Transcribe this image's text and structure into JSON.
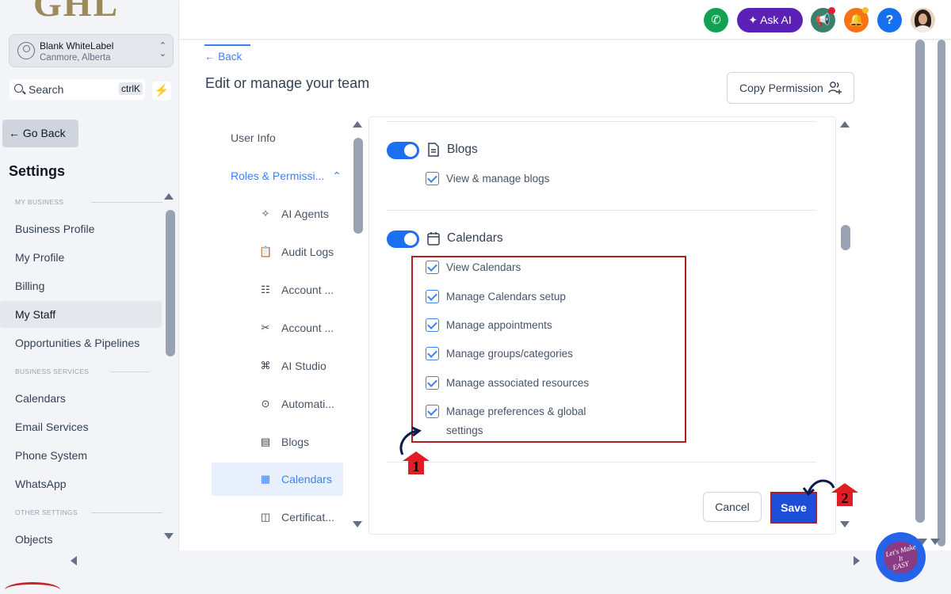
{
  "brand": {
    "logo_text": "GHL"
  },
  "account": {
    "name": "Blank WhiteLabel",
    "location": "Canmore, Alberta"
  },
  "search": {
    "label": "Search",
    "shortcut": "ctrlK"
  },
  "sidebar": {
    "go_back": "← Go Back",
    "title": "Settings",
    "sections": {
      "my_business": "MY BUSINESS",
      "business_services": "BUSINESS SERVICES",
      "other_settings": "OTHER SETTINGS"
    },
    "items": [
      {
        "label": "Business Profile"
      },
      {
        "label": "My Profile"
      },
      {
        "label": "Billing"
      },
      {
        "label": "My Staff",
        "active": true
      },
      {
        "label": "Opportunities & Pipelines"
      },
      {
        "label": "Calendars"
      },
      {
        "label": "Email Services"
      },
      {
        "label": "Phone System"
      },
      {
        "label": "WhatsApp"
      },
      {
        "label": "Objects"
      }
    ]
  },
  "topbar": {
    "ask_ai": "Ask AI",
    "help": "?",
    "colors": {
      "phone": "#12a150",
      "ask_ai": "#5b21b6",
      "megaphone": "#3b7f6d",
      "bell": "#f97316",
      "help": "#1570ef"
    }
  },
  "main": {
    "back": "← Back",
    "title": "Edit or manage your team",
    "copy_permission": "Copy Permission"
  },
  "submenu": {
    "user_info": "User Info",
    "roles": "Roles & Permissi...",
    "items": [
      {
        "label": "AI Agents",
        "icon": "sparkle-icon"
      },
      {
        "label": "Audit Logs",
        "icon": "clipboard-check-icon"
      },
      {
        "label": "Account ...",
        "icon": "toggles-icon"
      },
      {
        "label": "Account ...",
        "icon": "tools-icon"
      },
      {
        "label": "AI Studio",
        "icon": "ai-studio-icon"
      },
      {
        "label": "Automati...",
        "icon": "play-circle-icon"
      },
      {
        "label": "Blogs",
        "icon": "document-icon"
      },
      {
        "label": "Calendars",
        "icon": "calendar-icon",
        "active": true
      },
      {
        "label": "Certificat...",
        "icon": "certificate-icon"
      }
    ]
  },
  "permissions": {
    "blogs": {
      "title": "Blogs",
      "enabled": true,
      "options": [
        "View & manage blogs"
      ]
    },
    "calendars": {
      "title": "Calendars",
      "enabled": true,
      "options": [
        "View Calendars",
        "Manage Calendars setup",
        "Manage appointments",
        "Manage groups/categories",
        "Manage associated resources",
        "Manage preferences & global",
        "settings"
      ]
    }
  },
  "actions": {
    "cancel": "Cancel",
    "save": "Save"
  },
  "annotations": {
    "step1": "1",
    "step2": "2"
  },
  "badge": {
    "line1": "Let's Make",
    "line2": "It",
    "line3": "EASY"
  }
}
